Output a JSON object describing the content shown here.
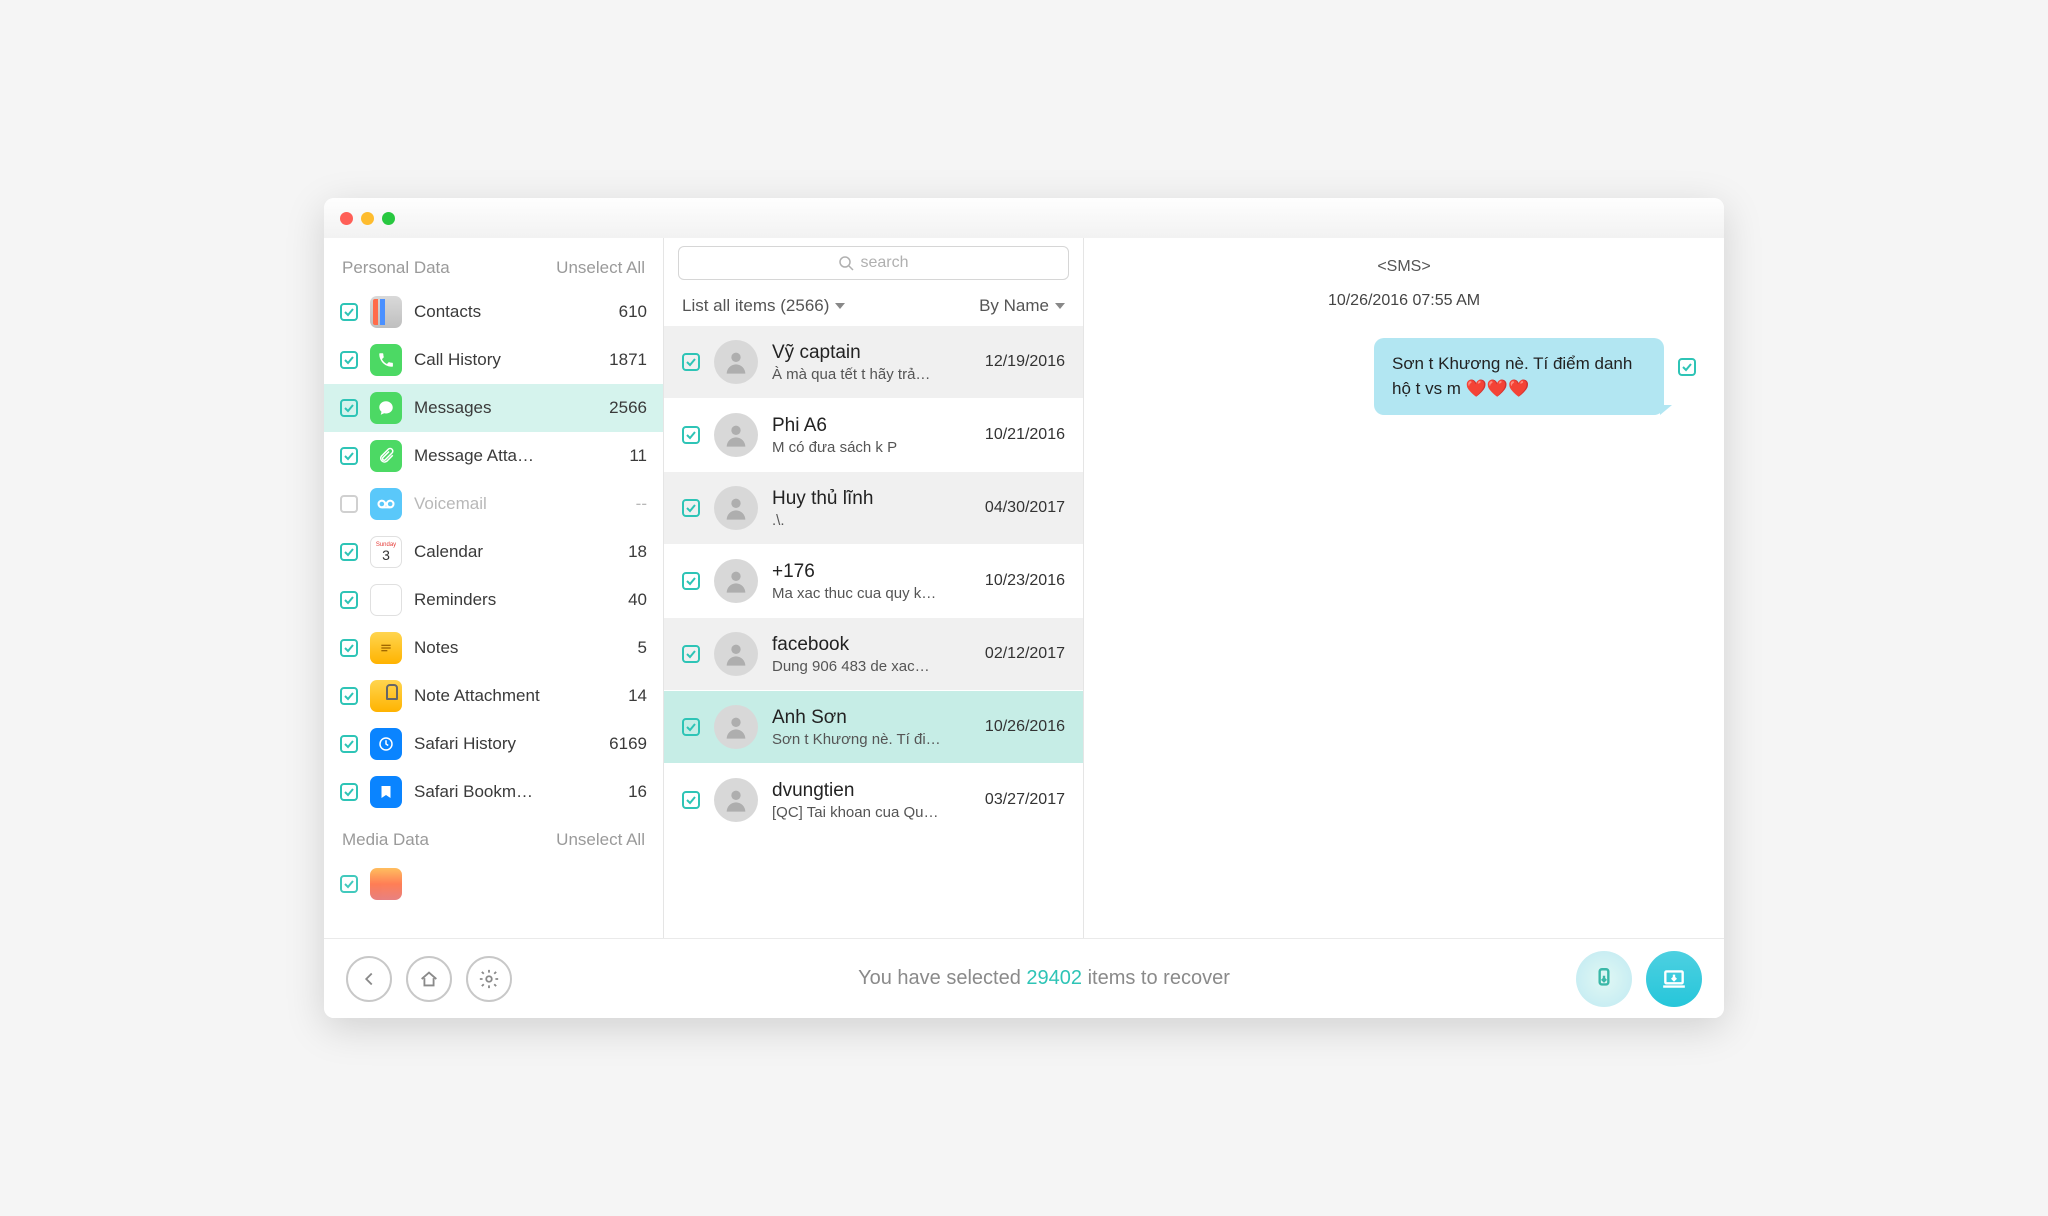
{
  "search": {
    "placeholder": "search"
  },
  "sidebar": {
    "section1": "Personal Data",
    "section2": "Media Data",
    "unselect": "Unselect All",
    "items": [
      {
        "label": "Contacts",
        "count": "610",
        "enabled": true
      },
      {
        "label": "Call History",
        "count": "1871",
        "enabled": true
      },
      {
        "label": "Messages",
        "count": "2566",
        "enabled": true,
        "active": true
      },
      {
        "label": "Message Atta…",
        "count": "11",
        "enabled": true
      },
      {
        "label": "Voicemail",
        "count": "--",
        "enabled": false
      },
      {
        "label": "Calendar",
        "count": "18",
        "enabled": true
      },
      {
        "label": "Reminders",
        "count": "40",
        "enabled": true
      },
      {
        "label": "Notes",
        "count": "5",
        "enabled": true
      },
      {
        "label": "Note Attachment",
        "count": "14",
        "enabled": true
      },
      {
        "label": "Safari History",
        "count": "6169",
        "enabled": true
      },
      {
        "label": "Safari Bookm…",
        "count": "16",
        "enabled": true
      }
    ]
  },
  "filter": {
    "left": "List all items (2566)",
    "right": "By Name"
  },
  "threads": [
    {
      "name": "Vỹ captain",
      "preview": "À mà qua tết t hãy trả…",
      "date": "12/19/2016",
      "alt": true
    },
    {
      "name": "Phi A6",
      "preview": "M có đưa sách k P",
      "date": "10/21/2016",
      "alt": false
    },
    {
      "name": "Huy thủ lĩnh",
      "preview": ".\\.",
      "date": "04/30/2017",
      "alt": true
    },
    {
      "name": "+176",
      "preview": "Ma xac thuc cua quy k…",
      "date": "10/23/2016",
      "alt": false
    },
    {
      "name": "facebook",
      "preview": "Dung 906 483 de xac…",
      "date": "02/12/2017",
      "alt": true
    },
    {
      "name": "Anh Sơn",
      "preview": "Sơn t Khương nè. Tí đi…",
      "date": "10/26/2016",
      "sel": true
    },
    {
      "name": "dvungtien",
      "preview": "[QC] Tai khoan cua Qu…",
      "date": "03/27/2017",
      "alt": false
    }
  ],
  "detail": {
    "tag": "<SMS>",
    "datetime": "10/26/2016 07:55 AM",
    "bubble": "Sơn t Khương nè. Tí điểm danh hộ t vs m ❤️❤️❤️"
  },
  "footer": {
    "pre": "You have selected ",
    "count": "29402",
    "post": " items to recover"
  },
  "cal": {
    "top": "Sunday",
    "day": "3"
  }
}
